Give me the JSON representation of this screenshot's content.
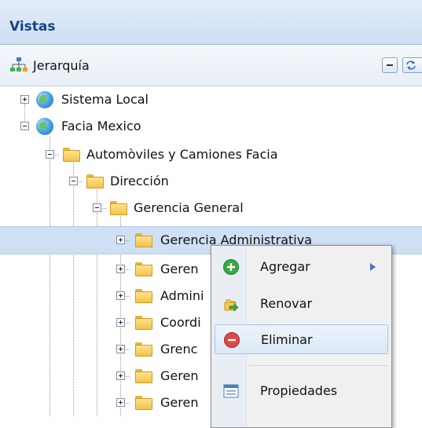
{
  "panel": {
    "title": "Vistas"
  },
  "toolbar": {
    "title": "Jerarquía"
  },
  "tree": [
    {
      "label": "Sistema Local",
      "icon": "globe-icon"
    },
    {
      "label": "Facia Mexico",
      "icon": "globe-icon"
    },
    {
      "label": "Automòviles y Camiones Facia",
      "icon": "folder-icon"
    },
    {
      "label": "Dirección",
      "icon": "folder-icon"
    },
    {
      "label": "Gerencia General",
      "icon": "folder-icon"
    },
    {
      "label": "Gerencia Administrativa",
      "icon": "folder-icon"
    },
    {
      "label": "Geren",
      "icon": "folder-icon"
    },
    {
      "label": "Admini",
      "icon": "folder-icon"
    },
    {
      "label": "Coordi",
      "icon": "folder-icon"
    },
    {
      "label": "Grenc",
      "icon": "folder-icon"
    },
    {
      "label": "Geren",
      "icon": "folder-icon"
    },
    {
      "label": "Geren",
      "icon": "folder-icon"
    }
  ],
  "context_menu": {
    "items": [
      {
        "label": "Agregar",
        "icon": "add-icon"
      },
      {
        "label": "Renovar",
        "icon": "refresh-icon"
      },
      {
        "label": "Eliminar",
        "icon": "delete-icon"
      },
      {
        "label": "Propiedades",
        "icon": "properties-icon"
      }
    ]
  },
  "colors": {
    "selected_row": "#cfdff4",
    "title_text": "#15428b",
    "menu_hover_border": "#a9c4e6"
  }
}
